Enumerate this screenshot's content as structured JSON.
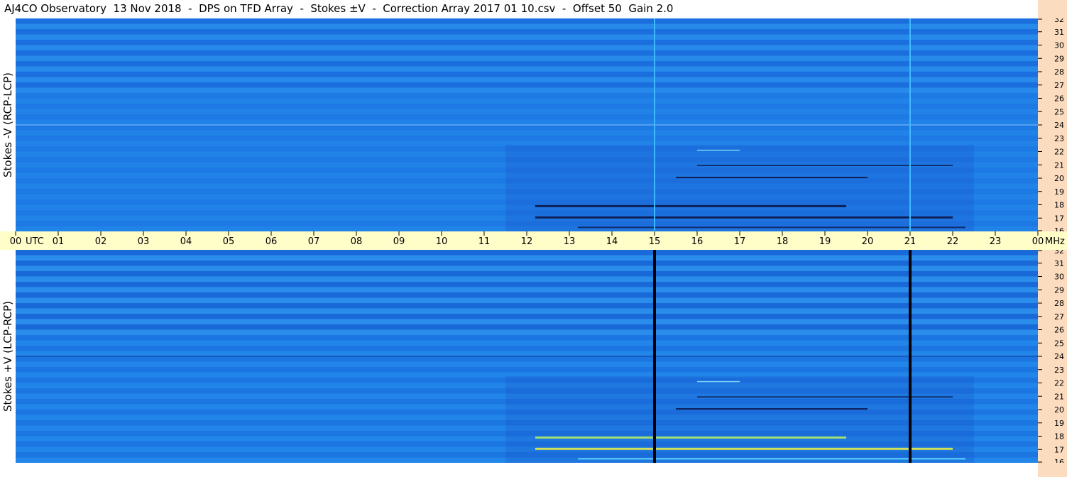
{
  "title": "AJ4CO Observatory  13 Nov 2018  -  DPS on TFD Array  -  Stokes ±V  -  Correction Array 2017 01 10.csv  -  Offset 50  Gain 2.0",
  "colors": {
    "background_blue": "#1e7fe8",
    "dark_band_blue": "#1650c8",
    "light_blue": "#3aa0f0",
    "time_axis_bg": "#fffdc8",
    "freq_strip_bg": "#fcdcbf",
    "hot_yellow": "#f0f040"
  },
  "chart_data": [
    {
      "type": "heatmap",
      "panel": "top",
      "ylabel": "Stokes -V (RCP-LCP)",
      "xlabel": "UTC",
      "x_ticks": [
        "00",
        "01",
        "02",
        "03",
        "04",
        "05",
        "06",
        "07",
        "08",
        "09",
        "10",
        "11",
        "12",
        "13",
        "14",
        "15",
        "16",
        "17",
        "18",
        "19",
        "20",
        "21",
        "22",
        "23",
        "00"
      ],
      "x_unit_label": "UTC",
      "xlim": [
        0,
        24
      ],
      "y_unit_label": "MHz",
      "y_ticks": [
        16,
        17,
        18,
        19,
        20,
        21,
        22,
        23,
        24,
        25,
        26,
        27,
        28,
        29,
        30,
        31,
        32
      ],
      "ylim": [
        16,
        32
      ],
      "vertical_lines_utc": [
        15.0,
        21.0
      ],
      "vertical_line_color": "#40b8ff"
    },
    {
      "type": "heatmap",
      "panel": "bottom",
      "ylabel": "Stokes +V (LCP-RCP)",
      "xlabel": "UTC",
      "x_ticks": [
        "00",
        "01",
        "02",
        "03",
        "04",
        "05",
        "06",
        "07",
        "08",
        "09",
        "10",
        "11",
        "12",
        "13",
        "14",
        "15",
        "16",
        "17",
        "18",
        "19",
        "20",
        "21",
        "22",
        "23",
        "00"
      ],
      "x_unit_label": "UTC",
      "xlim": [
        0,
        24
      ],
      "y_unit_label": "MHz",
      "y_ticks": [
        16,
        17,
        18,
        19,
        20,
        21,
        22,
        23,
        24,
        25,
        26,
        27,
        28,
        29,
        30,
        31,
        32
      ],
      "ylim": [
        16,
        32
      ],
      "vertical_lines_utc": [
        15.0,
        21.0
      ],
      "vertical_line_color": "#000000"
    }
  ]
}
